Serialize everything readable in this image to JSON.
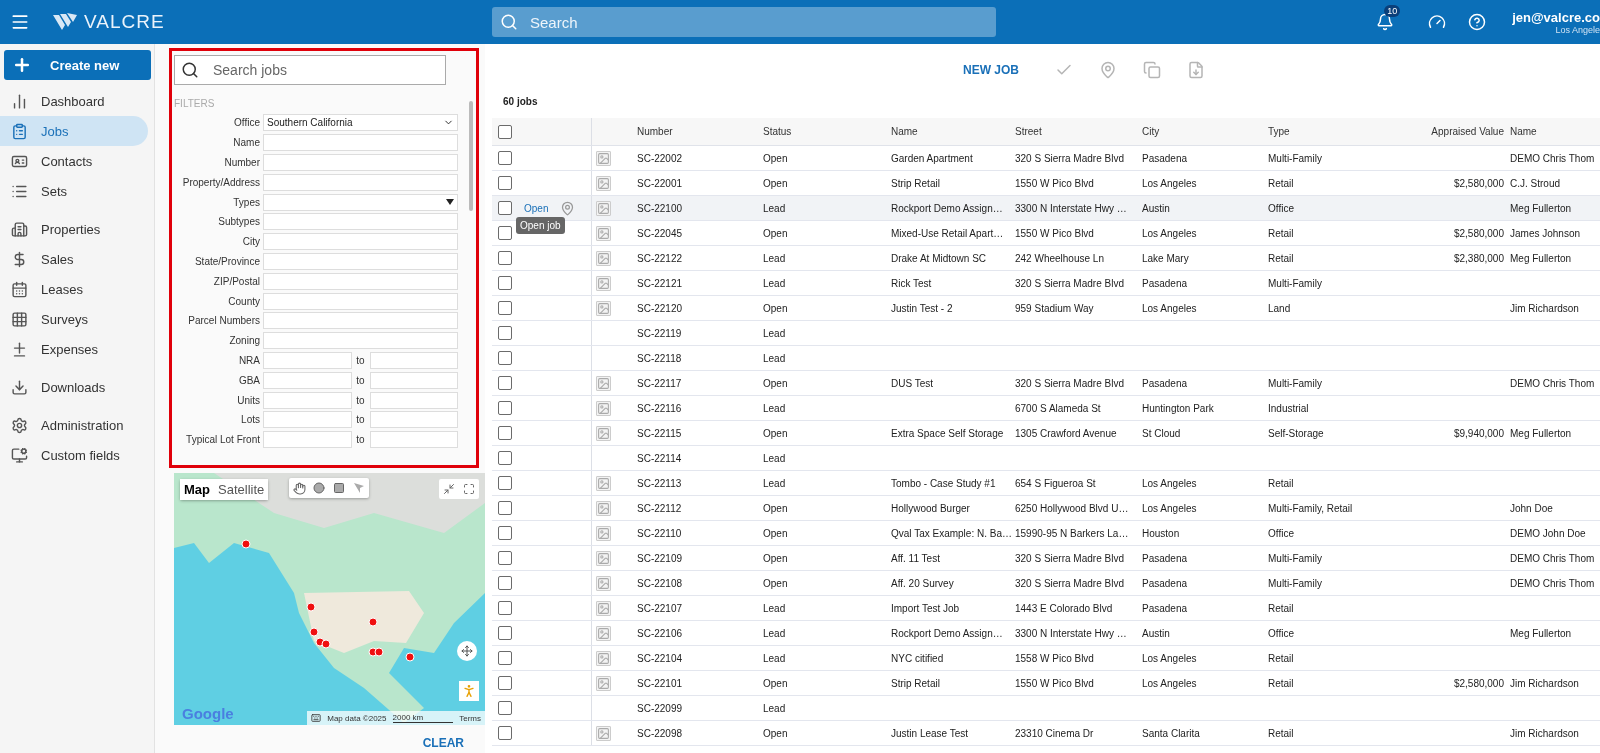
{
  "topbar": {
    "brand": "VALCRE",
    "search_placeholder": "Search",
    "notification_count": "10",
    "user_email": "jen@valcre.co",
    "user_location": "Los Angele"
  },
  "sidebar": {
    "create_button": "Create new",
    "groups": [
      [
        {
          "label": "Dashboard",
          "selected": false
        },
        {
          "label": "Jobs",
          "selected": true
        },
        {
          "label": "Contacts",
          "selected": false
        },
        {
          "label": "Sets",
          "selected": false
        }
      ],
      [
        {
          "label": "Properties",
          "selected": false
        },
        {
          "label": "Sales",
          "selected": false
        },
        {
          "label": "Leases",
          "selected": false
        },
        {
          "label": "Surveys",
          "selected": false
        },
        {
          "label": "Expenses",
          "selected": false
        }
      ],
      [
        {
          "label": "Downloads",
          "selected": false
        }
      ],
      [
        {
          "label": "Administration",
          "selected": false
        },
        {
          "label": "Custom fields",
          "selected": false
        }
      ]
    ]
  },
  "filters": {
    "search_placeholder": "Search jobs",
    "heading": "FILTERS",
    "fields": [
      {
        "kind": "select",
        "label": "Office",
        "value": "Southern California"
      },
      {
        "kind": "text",
        "label": "Name"
      },
      {
        "kind": "text",
        "label": "Number"
      },
      {
        "kind": "text",
        "label": "Property/Address"
      },
      {
        "kind": "dropdown",
        "label": "Types"
      },
      {
        "kind": "text",
        "label": "Subtypes"
      },
      {
        "kind": "text",
        "label": "City"
      },
      {
        "kind": "text",
        "label": "State/Province"
      },
      {
        "kind": "text",
        "label": "ZIP/Postal"
      },
      {
        "kind": "text",
        "label": "County"
      },
      {
        "kind": "text",
        "label": "Parcel Numbers"
      },
      {
        "kind": "text",
        "label": "Zoning"
      },
      {
        "kind": "range",
        "label": "NRA",
        "to": "to"
      },
      {
        "kind": "range",
        "label": "GBA",
        "to": "to"
      },
      {
        "kind": "range",
        "label": "Units",
        "to": "to"
      },
      {
        "kind": "range",
        "label": "Lots",
        "to": "to"
      },
      {
        "kind": "range",
        "label": "Typical Lot Front",
        "to": "to"
      }
    ]
  },
  "map": {
    "type_buttons": [
      {
        "label": "Map",
        "selected": true
      },
      {
        "label": "Satellite",
        "selected": false
      }
    ],
    "logo": "Google",
    "attribution": "Map data ©2025",
    "scale": "2000 km",
    "terms": "Terms"
  },
  "clear_button": "CLEAR",
  "toolbar": {
    "new_job": "NEW JOB"
  },
  "job_count": "60 jobs",
  "table": {
    "columns": [
      "Number",
      "Status",
      "Name",
      "Street",
      "City",
      "Type",
      "Appraised Value",
      "Name"
    ],
    "header_checked": false,
    "rows": [
      {
        "checked": false,
        "hovered": false,
        "thumb": true,
        "number": "SC-22002",
        "status": "Open",
        "name": "Garden Apartment",
        "street": "320 S Sierra Madre Blvd",
        "city": "Pasadena",
        "type": "Multi-Family",
        "owner": "DEMO Chris Thom"
      },
      {
        "checked": false,
        "hovered": false,
        "thumb": true,
        "number": "SC-22001",
        "status": "Open",
        "name": "Strip Retail",
        "street": "1550 W Pico Blvd",
        "city": "Los Angeles",
        "type": "Retail",
        "value": "$2,580,000",
        "owner": "C.J. Stroud"
      },
      {
        "checked": false,
        "hovered": true,
        "open_link": "Open",
        "tooltip": "Open job",
        "thumb": true,
        "number": "SC-22100",
        "status": "Lead",
        "name": "Rockport Demo Assign…",
        "street": "3300 N Interstate Hwy …",
        "city": "Austin",
        "type": "Office",
        "owner": "Meg Fullerton"
      },
      {
        "checked": false,
        "hovered": false,
        "thumb": true,
        "number": "SC-22045",
        "status": "Open",
        "name": "Mixed-Use Retail Apart…",
        "street": "1550 W Pico Blvd",
        "city": "Los Angeles",
        "type": "Retail",
        "value": "$2,580,000",
        "owner": "James Johnson"
      },
      {
        "checked": false,
        "hovered": false,
        "thumb": true,
        "number": "SC-22122",
        "status": "Lead",
        "name": "Drake At Midtown SC",
        "street": "242 Wheelhouse Ln",
        "city": "Lake Mary",
        "type": "Retail",
        "value": "$2,380,000",
        "owner": "Meg Fullerton"
      },
      {
        "checked": false,
        "hovered": false,
        "thumb": true,
        "number": "SC-22121",
        "status": "Lead",
        "name": "Rick Test",
        "street": "320 S Sierra Madre Blvd",
        "city": "Pasadena",
        "type": "Multi-Family"
      },
      {
        "checked": false,
        "hovered": false,
        "thumb": true,
        "number": "SC-22120",
        "status": "Open",
        "name": "Justin Test - 2",
        "street": "959 Stadium Way",
        "city": "Los Angeles",
        "type": "Land",
        "owner": "Jim Richardson"
      },
      {
        "checked": false,
        "hovered": false,
        "thumb": false,
        "number": "SC-22119",
        "status": "Lead"
      },
      {
        "checked": false,
        "hovered": false,
        "thumb": false,
        "number": "SC-22118",
        "status": "Lead"
      },
      {
        "checked": false,
        "hovered": false,
        "thumb": true,
        "number": "SC-22117",
        "status": "Open",
        "name": "DUS Test",
        "street": "320 S Sierra Madre Blvd",
        "city": "Pasadena",
        "type": "Multi-Family",
        "owner": "DEMO Chris Thom"
      },
      {
        "checked": false,
        "hovered": false,
        "thumb": true,
        "number": "SC-22116",
        "status": "Lead",
        "street": "6700 S Alameda St",
        "city": "Huntington Park",
        "type": "Industrial"
      },
      {
        "checked": false,
        "hovered": false,
        "thumb": true,
        "number": "SC-22115",
        "status": "Open",
        "name": "Extra Space Self Storage",
        "street": "1305 Crawford Avenue",
        "city": "St Cloud",
        "type": "Self-Storage",
        "value": "$9,940,000",
        "owner": "Meg Fullerton"
      },
      {
        "checked": false,
        "hovered": false,
        "thumb": false,
        "number": "SC-22114",
        "status": "Lead"
      },
      {
        "checked": false,
        "hovered": false,
        "thumb": true,
        "number": "SC-22113",
        "status": "Lead",
        "name": "Tombo - Case Study #1",
        "street": "654 S Figueroa St",
        "city": "Los Angeles",
        "type": "Retail"
      },
      {
        "checked": false,
        "hovered": false,
        "thumb": true,
        "number": "SC-22112",
        "status": "Open",
        "name": "Hollywood Burger",
        "street": "6250 Hollywood Blvd U…",
        "city": "Los Angeles",
        "type": "Multi-Family, Retail",
        "owner": "John Doe"
      },
      {
        "checked": false,
        "hovered": false,
        "thumb": true,
        "number": "SC-22110",
        "status": "Open",
        "name": "Qval Tax Example: N. Ba…",
        "street": "15990-95 N Barkers La…",
        "city": "Houston",
        "type": "Office",
        "owner": "DEMO John Doe"
      },
      {
        "checked": false,
        "hovered": false,
        "thumb": true,
        "number": "SC-22109",
        "status": "Open",
        "name": "Aff. 11 Test",
        "street": "320 S Sierra Madre Blvd",
        "city": "Pasadena",
        "type": "Multi-Family",
        "owner": "DEMO Chris Thom"
      },
      {
        "checked": false,
        "hovered": false,
        "thumb": true,
        "number": "SC-22108",
        "status": "Open",
        "name": "Aff. 20 Survey",
        "street": "320 S Sierra Madre Blvd",
        "city": "Pasadena",
        "type": "Multi-Family",
        "owner": "DEMO Chris Thom"
      },
      {
        "checked": false,
        "hovered": false,
        "thumb": true,
        "number": "SC-22107",
        "status": "Lead",
        "name": "Import Test Job",
        "street": "1443 E Colorado Blvd",
        "city": "Pasadena",
        "type": "Retail"
      },
      {
        "checked": false,
        "hovered": false,
        "thumb": true,
        "number": "SC-22106",
        "status": "Lead",
        "name": "Rockport Demo Assign…",
        "street": "3300 N Interstate Hwy …",
        "city": "Austin",
        "type": "Office",
        "owner": "Meg Fullerton"
      },
      {
        "checked": false,
        "hovered": false,
        "thumb": true,
        "number": "SC-22104",
        "status": "Lead",
        "name": "NYC citified",
        "street": "1558 W Pico Blvd",
        "city": "Los Angeles",
        "type": "Retail"
      },
      {
        "checked": false,
        "hovered": false,
        "thumb": true,
        "number": "SC-22101",
        "status": "Open",
        "name": "Strip Retail",
        "street": "1550 W Pico Blvd",
        "city": "Los Angeles",
        "type": "Retail",
        "value": "$2,580,000",
        "owner": "Jim Richardson"
      },
      {
        "checked": false,
        "hovered": false,
        "thumb": false,
        "number": "SC-22099",
        "status": "Lead"
      },
      {
        "checked": false,
        "hovered": false,
        "thumb": true,
        "number": "SC-22098",
        "status": "Open",
        "name": "Justin Lease Test",
        "street": "23310 Cinema Dr",
        "city": "Santa Clarita",
        "type": "Retail",
        "owner": "Jim Richardson"
      }
    ]
  }
}
